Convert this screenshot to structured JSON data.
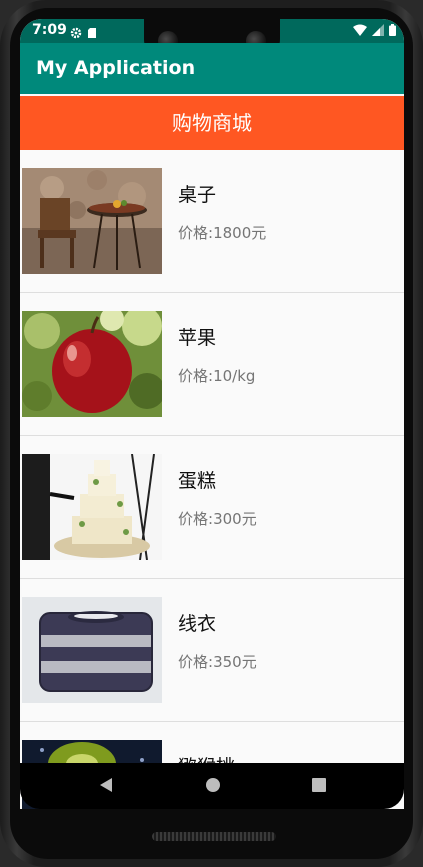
{
  "status_bar": {
    "time": "7:09",
    "left_icons": [
      "settings-icon",
      "sd-card-icon"
    ],
    "right_icons": [
      "wifi-icon",
      "signal-icon",
      "battery-icon"
    ]
  },
  "app_bar": {
    "title": "My Application",
    "color": "#00897b"
  },
  "header": {
    "title": "购物商城",
    "color": "#ff5722"
  },
  "products": [
    {
      "name": "桌子",
      "price_label": "价格:",
      "price": "1800元",
      "image": "table-and-chair-photo"
    },
    {
      "name": "苹果",
      "price_label": "价格:",
      "price": "10/kg",
      "image": "red-apple-photo"
    },
    {
      "name": "蛋糕",
      "price_label": "价格:",
      "price": "300元",
      "image": "wedding-cake-photo"
    },
    {
      "name": "线衣",
      "price_label": "价格:",
      "price": "350元",
      "image": "folded-sweater-photo"
    },
    {
      "name": "猕猴桃",
      "price_label": "",
      "price": "",
      "image": "kiwi-photo"
    }
  ],
  "nav_bar": {
    "buttons": [
      "back-icon",
      "home-icon",
      "recents-icon"
    ]
  }
}
